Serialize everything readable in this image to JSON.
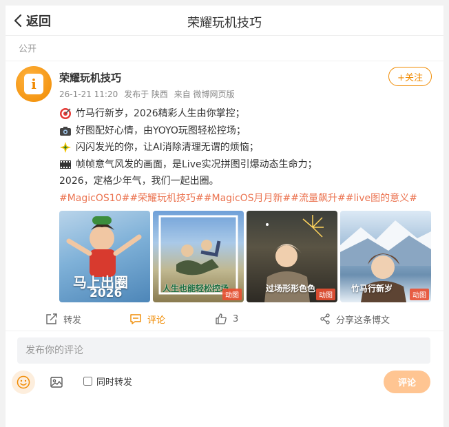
{
  "header": {
    "back_label": "返回",
    "title": "荣耀玩机技巧"
  },
  "visibility": "公开",
  "author": {
    "name": "荣耀玩机技巧",
    "avatar_letter": "i",
    "time": "26-1-21 11:20",
    "location": "发布于 陕西",
    "source": "来自 微博网页版",
    "follow_label": "+关注"
  },
  "post": {
    "lines": [
      {
        "icon": "target-icon",
        "text": "竹马行新岁，2026精彩人生由你掌控；"
      },
      {
        "icon": "camera-icon",
        "text": "好图配好心情，由YOYO玩图轻松控场；"
      },
      {
        "icon": "sparkle-icon",
        "text": "闪闪发光的你，让AI消除清理无谓的烦恼；"
      },
      {
        "icon": "film-icon",
        "text": "帧帧意气风发的画面，是Live实况拼图引爆动态生命力；"
      },
      {
        "icon": null,
        "text": "2026，定格少年气，我们一起出圈。"
      }
    ],
    "tags": "#MagicOS10##荣耀玩机技巧##MagicOS月月新##流量飙升##live图的意义#"
  },
  "images": [
    {
      "overlay": "马上出圈",
      "year": "2026",
      "badge": ""
    },
    {
      "overlay": "人生也能轻松控场",
      "year": "",
      "badge": "动图"
    },
    {
      "overlay": "过场形形色色",
      "year": "",
      "badge": "动图"
    },
    {
      "overlay": "竹马行新岁",
      "year": "",
      "badge": "动图"
    }
  ],
  "actions": {
    "repost": "转发",
    "comment": "评论",
    "like_count": "3",
    "share": "分享这条博文"
  },
  "comment_box": {
    "placeholder": "发布你的评论",
    "repost_label": "同时转发",
    "submit_label": "评论"
  },
  "colors": {
    "accent": "#f08a00",
    "tag": "#eb7350",
    "submit_bg": "#ffc592"
  }
}
